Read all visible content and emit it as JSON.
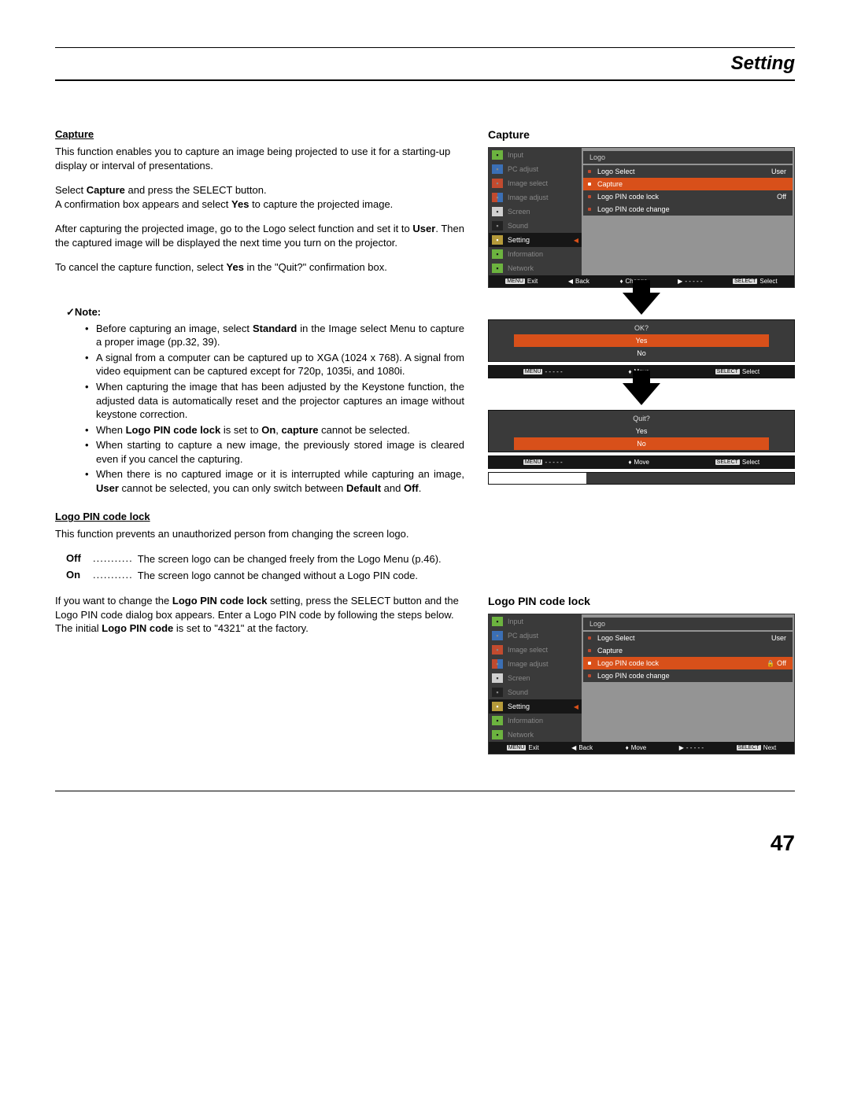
{
  "header": {
    "title": "Setting"
  },
  "page_number": "47",
  "capture": {
    "heading": "Capture",
    "p1": "This function enables you to capture an image being projected to use it for a starting-up display or interval of presentations.",
    "p2_pre": "Select ",
    "p2_b1": "Capture",
    "p2_mid": " and press the SELECT button.\nA confirmation box appears and select ",
    "p2_b2": "Yes",
    "p2_post": " to capture the projected image.",
    "p3_pre": "After capturing the projected image, go to the Logo select function and set it to ",
    "p3_b1": "User",
    "p3_post": ". Then the captured image will be displayed the next time you turn on the projector.",
    "p4_pre": "To cancel the capture function, select ",
    "p4_b1": "Yes",
    "p4_post": " in the \"Quit?\" confirmation box."
  },
  "note": {
    "check": "✓",
    "label": "Note:",
    "n1_pre": "Before capturing an image, select ",
    "n1_b1": "Standard",
    "n1_post": " in the Image select Menu to capture a proper image (pp.32, 39).",
    "n2": "A signal from a computer can be captured up to XGA (1024 x 768). A signal from video equipment can be captured except for 720p, 1035i, and 1080i.",
    "n3": "When capturing the image that has been adjusted by the Keystone function, the adjusted data is automatically reset and the projector captures an image without keystone correction.",
    "n4_pre": "When ",
    "n4_b1": "Logo PIN code lock",
    "n4_mid": " is set to ",
    "n4_b2": "On",
    "n4_mid2": ", ",
    "n4_b3": "capture",
    "n4_post": " cannot be selected.",
    "n5": "When starting to capture a new image, the previously stored image is cleared even if you cancel the capturing.",
    "n6_pre": "When there is no captured image or it is interrupted while capturing an image, ",
    "n6_b1": "User",
    "n6_mid": " cannot be selected, you can only switch between ",
    "n6_b2": "Default",
    "n6_mid2": " and ",
    "n6_b3": "Off",
    "n6_post": "."
  },
  "logo_lock": {
    "heading": "Logo PIN code lock",
    "intro": "This function prevents an unauthorized person from changing the screen logo.",
    "off_label": "Off",
    "off_text": "The screen logo can be changed freely from the Logo Menu (p.46).",
    "on_label": "On",
    "on_text": "The screen logo cannot be changed without a Logo PIN code.",
    "p2_pre": "If you want to change the ",
    "p2_b1": "Logo PIN code lock",
    "p2_mid": " setting, press the SELECT button and the Logo PIN code dialog box appears. Enter a Logo PIN code by following the steps below. The initial ",
    "p2_b2": "Logo PIN code",
    "p2_post": " is set to \"4321\" at the factory."
  },
  "sidebar_items": [
    {
      "label": "Input",
      "icon": "i-gr"
    },
    {
      "label": "PC adjust",
      "icon": "i-bl"
    },
    {
      "label": "Image select",
      "icon": "i-rd"
    },
    {
      "label": "Image adjust",
      "icon": "i-mx"
    },
    {
      "label": "Screen",
      "icon": "i-wh"
    },
    {
      "label": "Sound",
      "icon": "i-dk"
    },
    {
      "label": "Setting",
      "icon": "i-yl",
      "active": true
    },
    {
      "label": "Information",
      "icon": "i-gr"
    },
    {
      "label": "Network",
      "icon": "i-gr"
    }
  ],
  "osd_capture": {
    "header": "Logo",
    "rows": [
      {
        "label": "Logo Select",
        "value": "User"
      },
      {
        "label": "Capture",
        "value": "",
        "sel": true
      },
      {
        "label": "Logo PIN code lock",
        "value": "Off"
      },
      {
        "label": "Logo PIN code change",
        "value": ""
      }
    ],
    "nav": {
      "menu": "MENU",
      "exit": "Exit",
      "back": "Back",
      "change": "Change",
      "dashes": "- - - - -",
      "select": "SELECT",
      "sel_label": "Select"
    }
  },
  "osd_dialog_ok": {
    "title": "OK?",
    "yes": "Yes",
    "no": "No",
    "nav_dashes": "- - - - -",
    "nav_move": "Move",
    "nav_select": "SELECT",
    "nav_sel_label": "Select"
  },
  "osd_dialog_quit": {
    "title": "Quit?",
    "yes": "Yes",
    "no": "No",
    "nav_dashes": "- - - - -",
    "nav_move": "Move",
    "nav_select": "SELECT",
    "nav_sel_label": "Select"
  },
  "osd_lock": {
    "header": "Logo",
    "rows": [
      {
        "label": "Logo Select",
        "value": "User"
      },
      {
        "label": "Capture",
        "value": ""
      },
      {
        "label": "Logo PIN code lock",
        "value": "Off",
        "sel": true,
        "lock": true
      },
      {
        "label": "Logo PIN code change",
        "value": ""
      }
    ],
    "nav": {
      "menu": "MENU",
      "exit": "Exit",
      "back": "Back",
      "move": "Move",
      "dashes": "- - - - -",
      "select": "SELECT",
      "next": "Next"
    }
  },
  "fig": {
    "capture": "Capture",
    "lock": "Logo PIN code lock"
  }
}
